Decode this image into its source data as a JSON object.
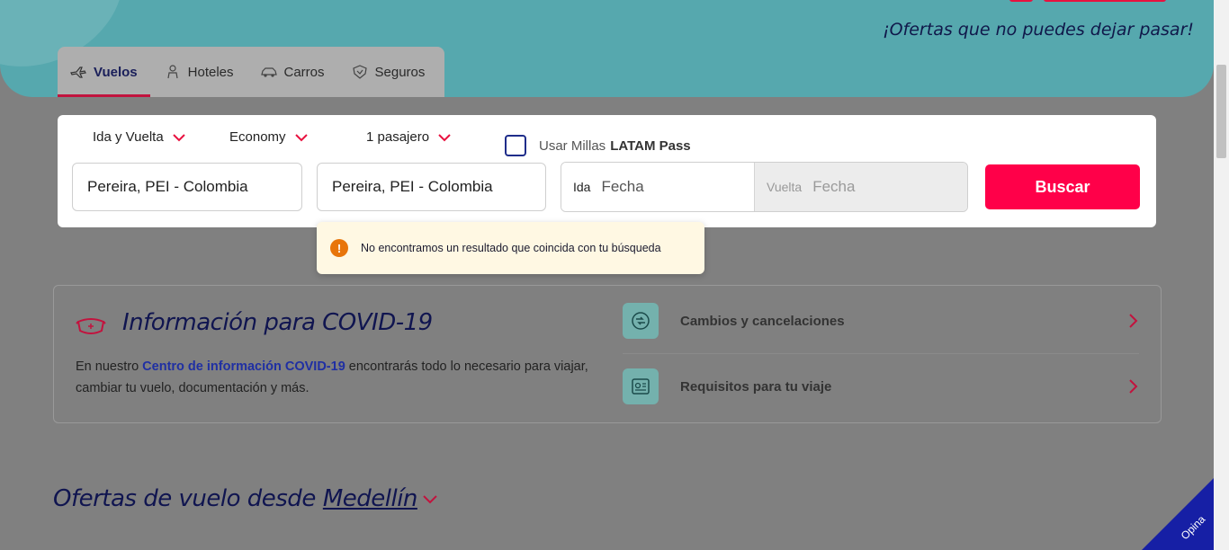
{
  "hero": {
    "tagline": "¡Ofertas que no puedes dejar pasar!"
  },
  "tabs": [
    {
      "label": "Vuelos",
      "icon": "plane-icon",
      "active": true
    },
    {
      "label": "Hoteles",
      "icon": "bellhop-icon"
    },
    {
      "label": "Carros",
      "icon": "car-icon"
    },
    {
      "label": "Seguros",
      "icon": "shield-icon"
    }
  ],
  "search": {
    "trip_type": "Ida y Vuelta",
    "cabin": "Economy",
    "passengers": "1 pasajero",
    "millas_label": "Usar Millas",
    "millas_brand": "LATAM Pass",
    "origin": "Pereira, PEI - Colombia",
    "destination": "Pereira, PEI - Colombia",
    "ida_label": "Ida",
    "ida_placeholder": "Fecha",
    "vuelta_label": "Vuelta",
    "vuelta_placeholder": "Fecha",
    "search_button": "Buscar"
  },
  "tooltip": {
    "icon": "!",
    "message": "No encontramos un resultado que coincida con tu búsqueda"
  },
  "covid": {
    "title": "Información para COVID-19",
    "text_before": "En nuestro ",
    "link": "Centro de información COVID-19",
    "text_after": " encontrarás todo lo necesario para viajar, cambiar tu vuelo, documentación y más.",
    "items": [
      {
        "label": "Cambios y cancelaciones",
        "icon": "exchange-icon"
      },
      {
        "label": "Requisitos para tu viaje",
        "icon": "document-icon"
      }
    ]
  },
  "offers": {
    "prefix": "Ofertas de vuelo desde",
    "city": "Medellín"
  },
  "feedback": {
    "label": "Opina"
  },
  "colors": {
    "accent": "#ff0049",
    "brand_blue": "#1f2fa3",
    "teal": "#56a8ae"
  }
}
